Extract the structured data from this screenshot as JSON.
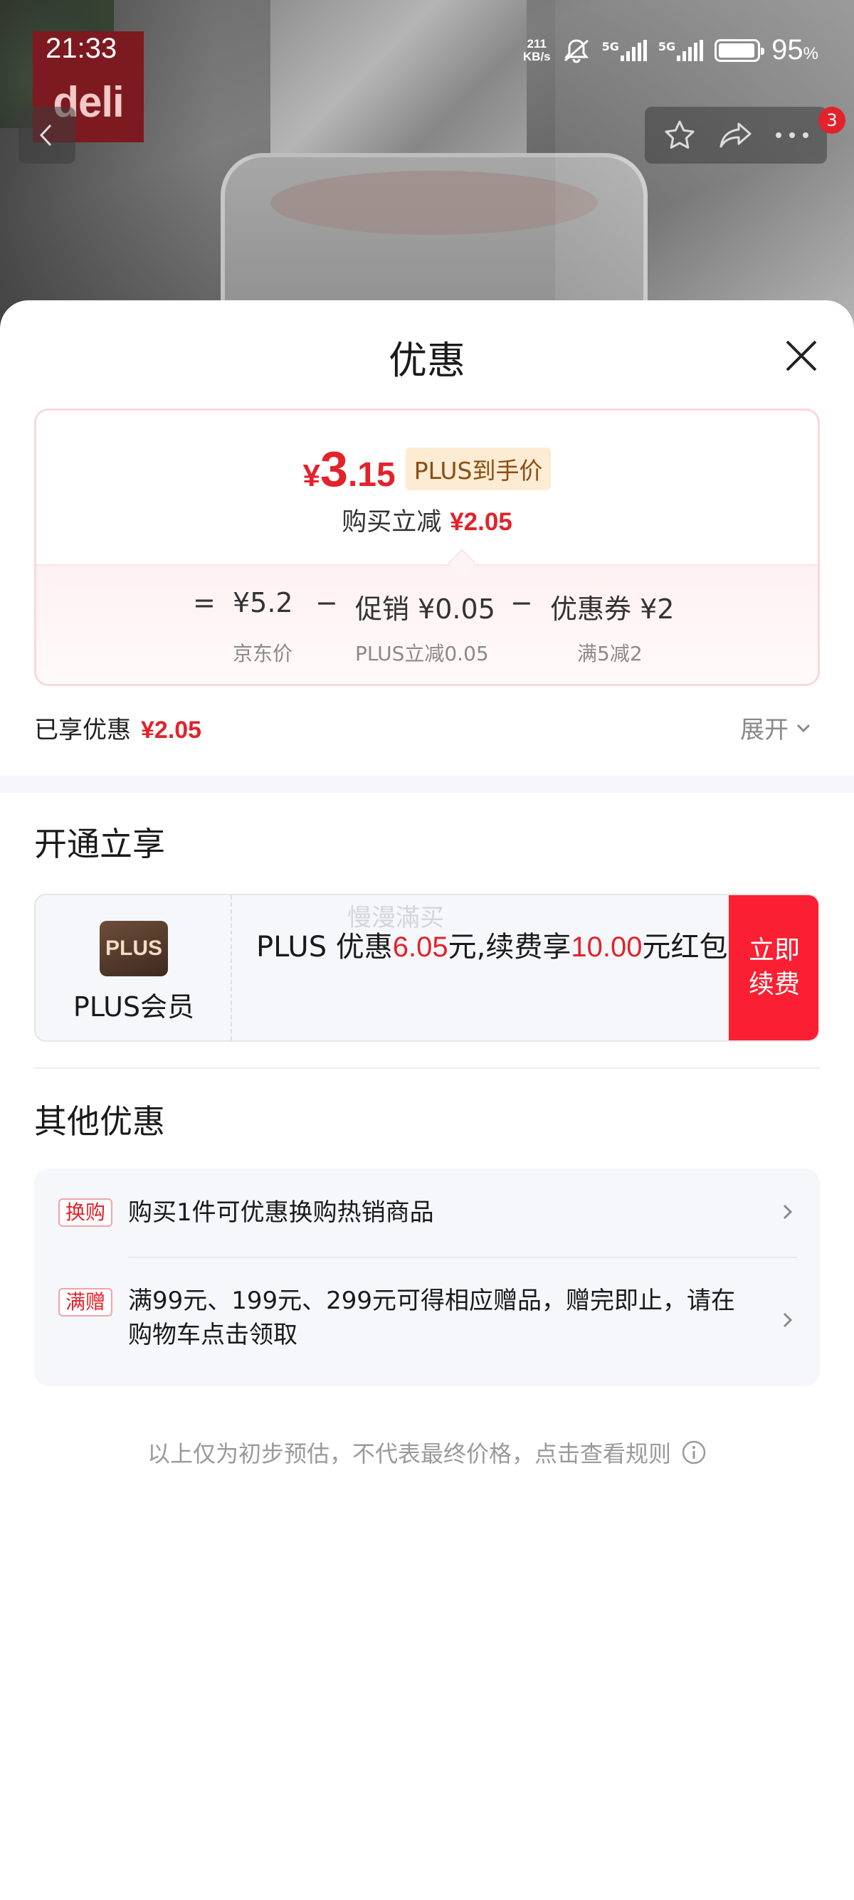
{
  "status_bar": {
    "time": "21:33",
    "net_speed_value": "211",
    "net_speed_unit": "KB/s",
    "sig1_label": "5G",
    "sig2_label": "5G",
    "battery_level": 0.95,
    "battery_percent": "95",
    "battery_unit": "%"
  },
  "photo": {
    "brand_logo": "deli"
  },
  "header_actions": {
    "badge_count": "3"
  },
  "sheet": {
    "title": "优惠"
  },
  "price_card": {
    "currency": "¥",
    "final_int": "3",
    "final_dec": ".15",
    "plus_tag": "PLUS到手价",
    "saving_label": "购买立减",
    "saving_value": "¥2.05",
    "formula": {
      "equals": "=",
      "base_price": "¥5.2",
      "minus1": "−",
      "promo": "促销 ¥0.05",
      "minus2": "−",
      "coupon": "优惠券 ¥2"
    },
    "formula_sub": {
      "base_label": "京东价",
      "promo_label": "PLUS立减0.05",
      "coupon_label": "满5减2"
    }
  },
  "enjoyed": {
    "label": "已享优惠",
    "value": "¥2.05",
    "expand_label": "展开"
  },
  "plus_section": {
    "title": "开通立享",
    "logo_text": "PLUS",
    "member_label": "PLUS会员",
    "watermark": "慢漫滿买",
    "desc_prefix": "PLUS 优惠",
    "desc_amount1": "6.05",
    "desc_mid": "元,续费享",
    "desc_amount2": "10.00",
    "desc_suffix": "元红包",
    "renew_button": "立即续费"
  },
  "other_section": {
    "title": "其他优惠",
    "items": [
      {
        "tag": "换购",
        "text": "购买1件可优惠换购热销商品"
      },
      {
        "tag": "满赠",
        "text": "满99元、199元、299元可得相应赠品，赠完即止，请在购物车点击领取"
      }
    ]
  },
  "footnote": {
    "text": "以上仅为初步预估，不代表最终价格，点击查看规则"
  },
  "colors": {
    "accent_red": "#e3222b",
    "renew_red": "#fa1f32",
    "plus_gold_bg": "#fdebd3"
  },
  "icons": {
    "back": "chevron-left-icon",
    "favorite": "star-icon",
    "share": "share-icon",
    "more": "more-dots-icon",
    "close": "close-icon",
    "expand": "chevron-down-icon",
    "row_arrow": "chevron-right-icon",
    "info": "info-icon"
  }
}
